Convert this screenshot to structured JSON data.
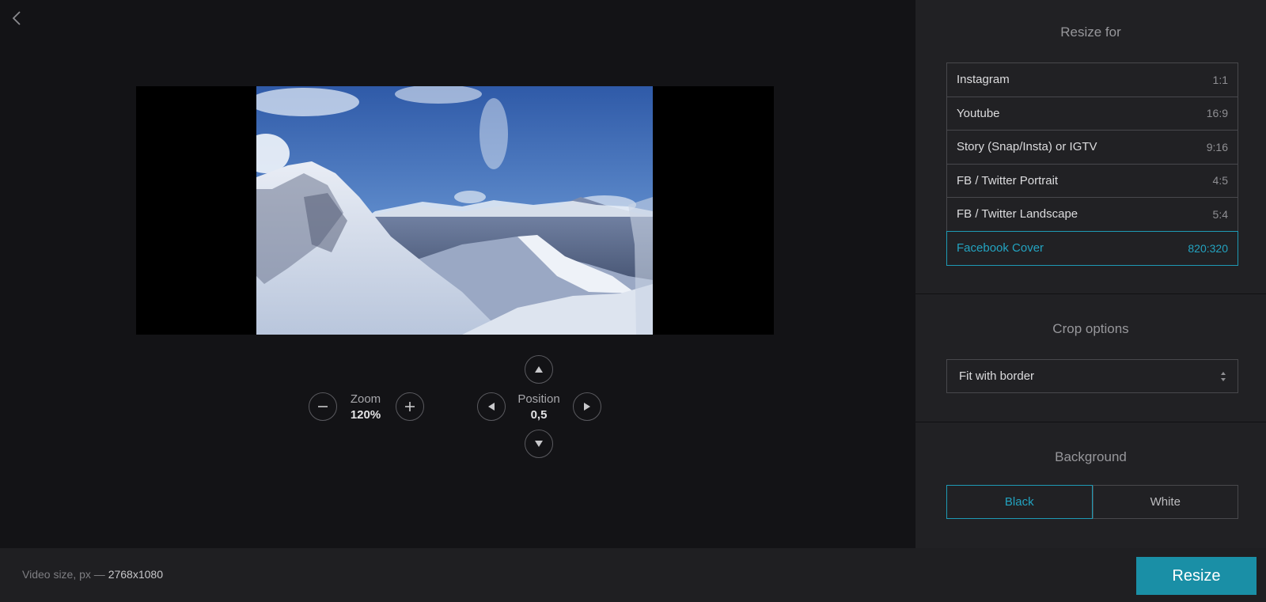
{
  "editor": {
    "zoom": {
      "label": "Zoom",
      "value": "120%"
    },
    "position": {
      "label": "Position",
      "value": "0,5"
    }
  },
  "sidebar": {
    "resize_for": {
      "title": "Resize for",
      "presets": [
        {
          "name": "Instagram",
          "ratio": "1:1",
          "active": false
        },
        {
          "name": "Youtube",
          "ratio": "16:9",
          "active": false
        },
        {
          "name": "Story (Snap/Insta) or IGTV",
          "ratio": "9:16",
          "active": false
        },
        {
          "name": "FB / Twitter Portrait",
          "ratio": "4:5",
          "active": false
        },
        {
          "name": "FB / Twitter Landscape",
          "ratio": "5:4",
          "active": false
        },
        {
          "name": "Facebook Cover",
          "ratio": "820:320",
          "active": true
        }
      ]
    },
    "crop_options": {
      "title": "Crop options",
      "selected": "Fit with border"
    },
    "background": {
      "title": "Background",
      "options": [
        {
          "label": "Black",
          "active": true
        },
        {
          "label": "White",
          "active": false
        }
      ]
    }
  },
  "footer": {
    "video_size_label": "Video size, px —",
    "video_size_value": "2768x1080",
    "resize_label": "Resize"
  },
  "colors": {
    "accent": "#23a3c0",
    "button": "#1a8fa6",
    "background": "#131316",
    "sidebar": "#212124"
  }
}
